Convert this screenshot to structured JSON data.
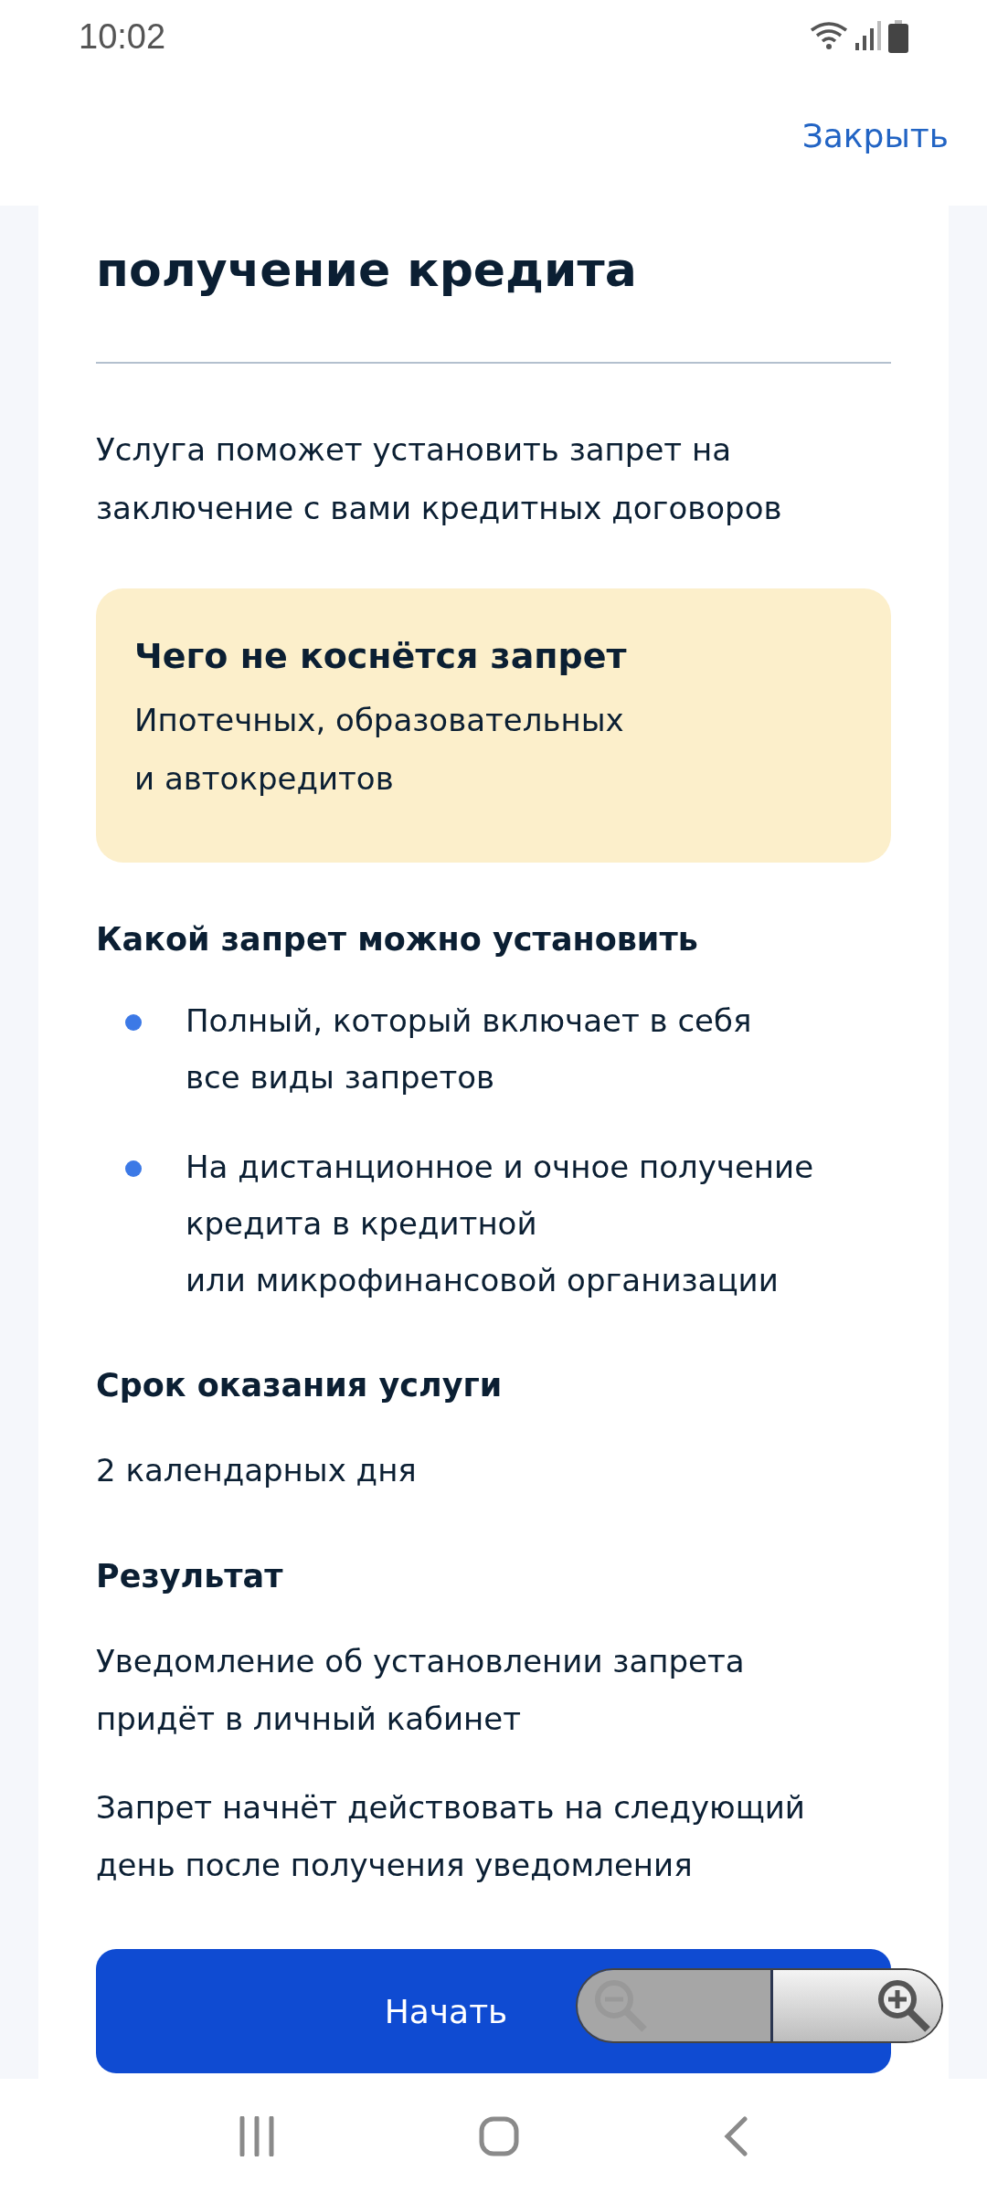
{
  "status_bar": {
    "time": "10:02"
  },
  "header": {
    "close_label": "Закрыть"
  },
  "title": "получение кредита",
  "intro": "Услуга поможет установить запрет на заключение с вами кредитных договоров",
  "notice": {
    "heading": "Чего не коснётся запрет",
    "text": "Ипотечных, образовательных\nи автокредитов"
  },
  "sections": [
    {
      "heading": "Какой запрет можно установить",
      "bullets": [
        "Полный, который включает в себя\nвсе виды запретов",
        "На дистанционное и очное получение\nкредита в кредитной\nили микрофинансовой организации"
      ]
    },
    {
      "heading": "Срок оказания услуги",
      "paragraphs": [
        "2 календарных дня"
      ]
    },
    {
      "heading": "Результат",
      "paragraphs": [
        "Уведомление об установлении запрета\nпридёт в личный кабинет",
        "Запрет начнёт действовать на следующий\nдень после получения уведомления"
      ]
    }
  ],
  "start_button": {
    "label": "Начать"
  }
}
